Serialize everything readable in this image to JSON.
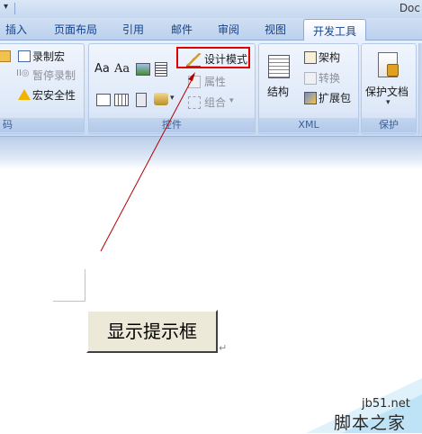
{
  "title_bar": {
    "app_title": "Doc",
    "qat_arrow": "▾"
  },
  "tabs": [
    {
      "label": "插入"
    },
    {
      "label": "页面布局"
    },
    {
      "label": "引用"
    },
    {
      "label": "邮件"
    },
    {
      "label": "审阅"
    },
    {
      "label": "视图"
    },
    {
      "label": "开发工具",
      "active": true
    }
  ],
  "ribbon": {
    "code_group": {
      "label": "码",
      "items": [
        "录制宏",
        "暂停录制",
        "宏安全性"
      ]
    },
    "controls_group": {
      "label": "控件",
      "rich_text": "Aa",
      "plain_text": "Aa",
      "design_mode": "设计模式",
      "properties": "属性",
      "group": "组合"
    },
    "xml_group": {
      "label": "XML",
      "structure": "结构",
      "schema": "架构",
      "transform": "转换",
      "expansion_packs": "扩展包"
    },
    "protect_group": {
      "label": "保护",
      "protect_document": "保护文档"
    }
  },
  "document": {
    "button_label": "显示提示框",
    "paragraph_mark": "↵"
  },
  "watermark": {
    "site": "jb51.net",
    "name": "脚本之家"
  },
  "colors": {
    "highlight": "#e00000",
    "arrow": "#b00000",
    "tab_text": "#15428b"
  }
}
